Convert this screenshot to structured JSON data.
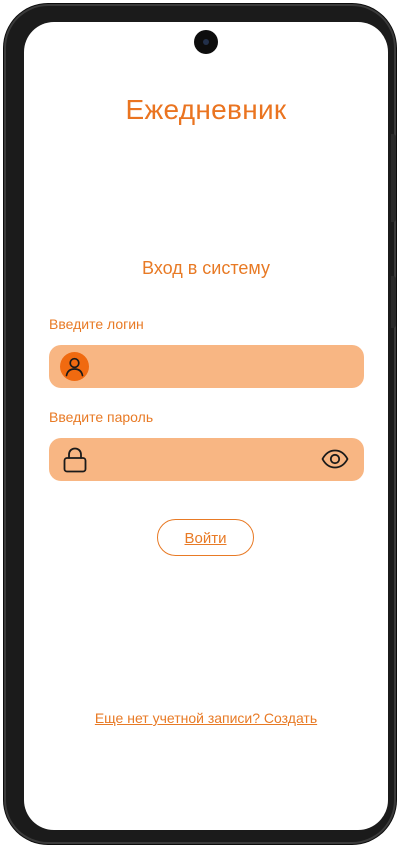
{
  "app": {
    "title": "Ежедневник"
  },
  "login_form": {
    "heading": "Вход в систему",
    "login_label": "Введите логин",
    "login_value": "",
    "password_label": "Введите пароль",
    "password_value": "",
    "submit_label": "Войти"
  },
  "footer": {
    "register_link": "Еще нет учетной записи? Создать"
  },
  "colors": {
    "accent": "#e87a25",
    "field_background": "#f8b683",
    "avatar_background": "#f06a10"
  },
  "icons": {
    "login_field": "user-icon",
    "password_field": "lock-icon",
    "password_toggle": "eye-icon"
  }
}
